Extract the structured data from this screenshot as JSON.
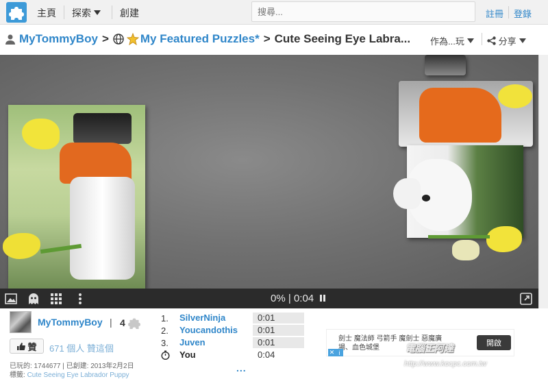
{
  "nav": {
    "home_label": "主頁",
    "explore_label": "探索",
    "create_label": "創建",
    "search_placeholder": "搜尋...",
    "register_label": "註冊",
    "login_label": "登錄"
  },
  "breadcrumb": {
    "owner": "MyTommyBoy",
    "collection": "My Featured Puzzles*",
    "title": "Cute Seeing Eye Labra...",
    "play_as_label": "作為...玩",
    "share_label": "分享"
  },
  "toolbar": {
    "progress": "0%",
    "timer": "0:04"
  },
  "owner": {
    "name": "MyTommyBoy",
    "pieces": "4",
    "like_label": "贊",
    "like_count_text": "671 個人 贊這個",
    "meta_line": "已玩的: 1744677 | 已創建: 2013年2月2日",
    "tags_label": "標籤:",
    "tags_value": "Cute Seeing Eye Labrador Puppy"
  },
  "leaderboard": [
    {
      "rank": "1.",
      "name": "SilverNinja",
      "time": "0:01"
    },
    {
      "rank": "2.",
      "name": "Youcandothis",
      "time": "0:01"
    },
    {
      "rank": "3.",
      "name": "Juven",
      "time": "0:01"
    },
    {
      "rank": "",
      "name": "You",
      "time": "0:04"
    }
  ],
  "leaderboard_more": "...",
  "ad": {
    "text": "劍士 魔法師 弓箭手 魔劍士 惡魔廣場、血色城堡",
    "button": "開啟"
  },
  "watermark": {
    "brand": "電腦王阿達",
    "url": "http://www.kocpc.com.tw"
  },
  "colors": {
    "accent": "#2f86c9",
    "toolbar": "#2b2b2b",
    "stage": "#727272"
  }
}
